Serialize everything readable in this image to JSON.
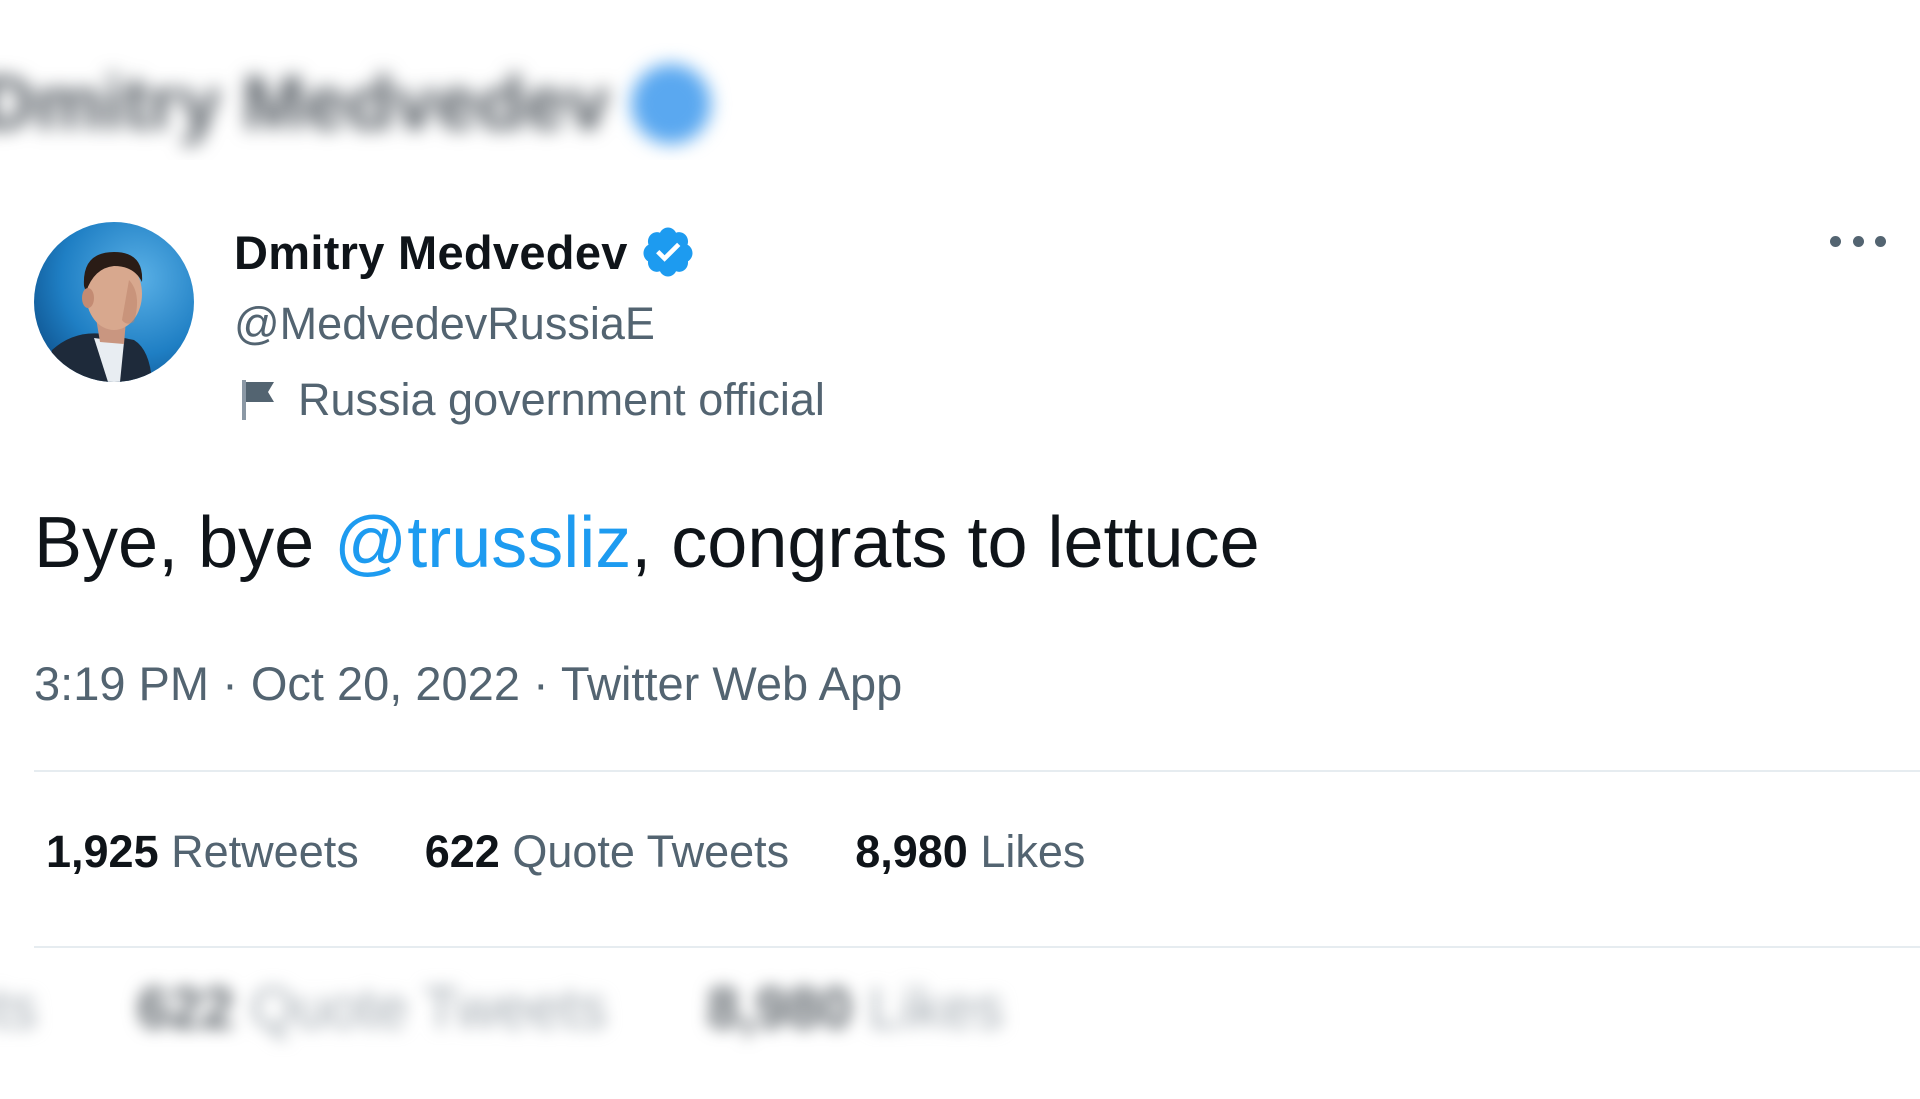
{
  "background": {
    "blurred_header": "Dmitry Medvedev",
    "blurred_footer": {
      "retweets_label": "ets",
      "quote_count": "622",
      "quote_label": "Quote Tweets",
      "likes_count": "8,980",
      "likes_label": "Likes"
    }
  },
  "tweet": {
    "author": {
      "display_name": "Dmitry Medvedev",
      "handle": "@MedvedevRussiaE",
      "label": "Russia government official",
      "verified": true
    },
    "text": {
      "before": "Bye, bye ",
      "mention": "@trussliz",
      "after": ", congrats to lettuce"
    },
    "meta": {
      "time": "3:19 PM",
      "separator": "·",
      "date": "Oct 20, 2022",
      "source": "Twitter Web App"
    },
    "stats": [
      {
        "count": "1,925",
        "label": "Retweets"
      },
      {
        "count": "622",
        "label": "Quote Tweets"
      },
      {
        "count": "8,980",
        "label": "Likes"
      }
    ]
  },
  "icons": {
    "verified": "verified-badge-icon",
    "label_flag": "flag-icon",
    "more": "more-options-icon"
  },
  "colors": {
    "accent": "#1d9bf0",
    "text_primary": "#0f1419",
    "text_secondary": "#536471",
    "divider": "#e6ecf0"
  }
}
